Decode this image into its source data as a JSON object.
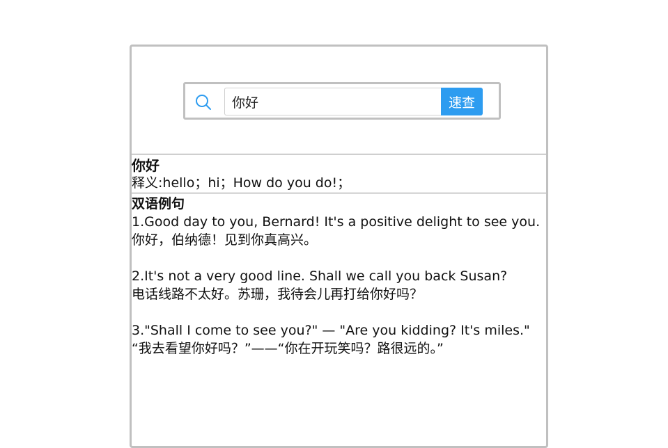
{
  "search": {
    "value": "你好",
    "button_label": "速查"
  },
  "result": {
    "word": "你好",
    "definition": "释义:hello；hi；How do you do!；",
    "examples_title": "双语例句",
    "examples": [
      {
        "en": "1.Good day to you, Bernard! It's a positive delight to see you.",
        "zh": "你好，伯纳德！见到你真高兴。"
      },
      {
        "en": "2.It's not a very good line. Shall we call you back Susan?",
        "zh": "电话线路不太好。苏珊，我待会儿再打给你好吗？"
      },
      {
        "en": "3.\"Shall I come to see you?\" — \"Are you kidding? It's miles.\"",
        "zh": "“我去看望你好吗？”——“你在开玩笑吗？路很远的。”"
      }
    ]
  },
  "colors": {
    "accent": "#2d9cf0",
    "border": "#c0c0c0",
    "divider": "#8a8a8a"
  },
  "icons": {
    "search": "search-icon"
  }
}
